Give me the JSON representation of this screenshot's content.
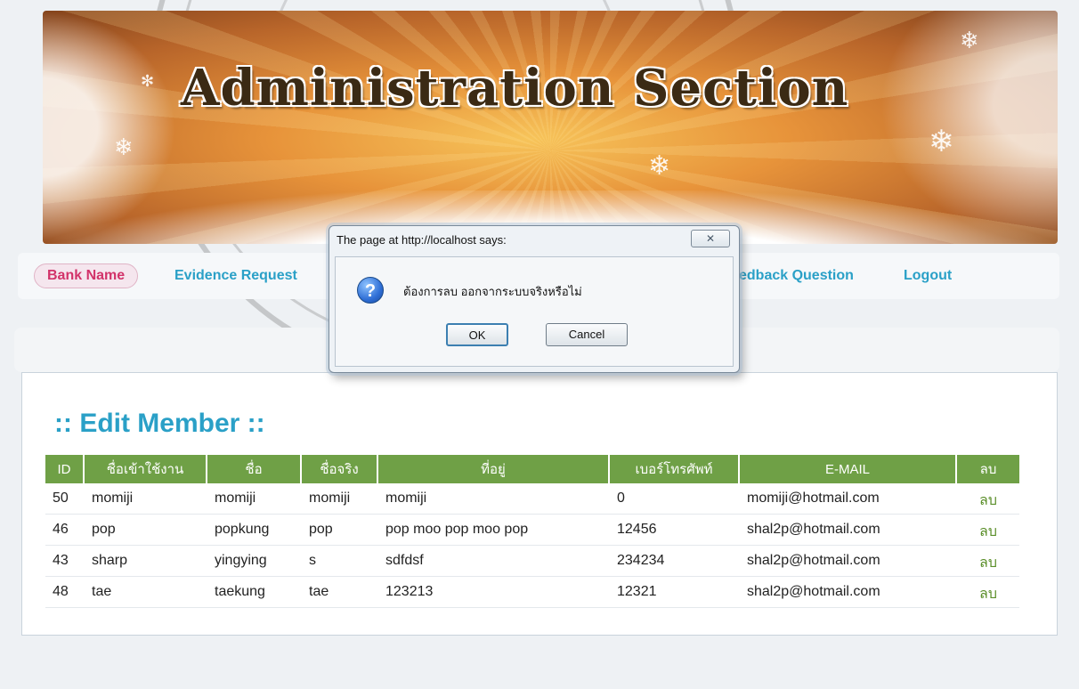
{
  "banner": {
    "title": "Administration Section"
  },
  "nav": {
    "items": [
      {
        "label": "Bank Name",
        "active": true
      },
      {
        "label": "Evidence Request"
      },
      {
        "label": "edback Question"
      },
      {
        "label": "Logout"
      }
    ]
  },
  "main": {
    "title": ":: Edit Member ::",
    "table": {
      "headers": [
        "ID",
        "ชื่อเข้าใช้งาน",
        "ชื่อ",
        "ชื่อจริง",
        "ที่อยู่",
        "เบอร์โทรศัพท์",
        "E-MAIL",
        "ลบ"
      ],
      "rows": [
        [
          "50",
          "momiji",
          "momiji",
          "momiji",
          "momiji",
          "0",
          "momiji@hotmail.com",
          "ลบ"
        ],
        [
          "46",
          "pop",
          "popkung",
          "pop",
          "pop moo pop moo pop",
          "12456",
          "shal2p@hotmail.com",
          "ลบ"
        ],
        [
          "43",
          "sharp",
          "yingying",
          "s",
          "sdfdsf",
          "234234",
          "shal2p@hotmail.com",
          "ลบ"
        ],
        [
          "48",
          "tae",
          "taekung",
          "tae",
          "123213",
          "12321",
          "shal2p@hotmail.com",
          "ลบ"
        ]
      ]
    }
  },
  "dialog": {
    "title": "The page at http://localhost says:",
    "close_glyph": "✕",
    "icon": "question-icon",
    "icon_glyph": "?",
    "message": "ต้องการลบ ออกจากระบบจริงหรือไม่",
    "ok_label": "OK",
    "cancel_label": "Cancel"
  },
  "colors": {
    "nav_link": "#2aa0c7",
    "nav_active": "#d2336a",
    "table_header": "#6fa046",
    "delete_link": "#5b8f2a"
  }
}
